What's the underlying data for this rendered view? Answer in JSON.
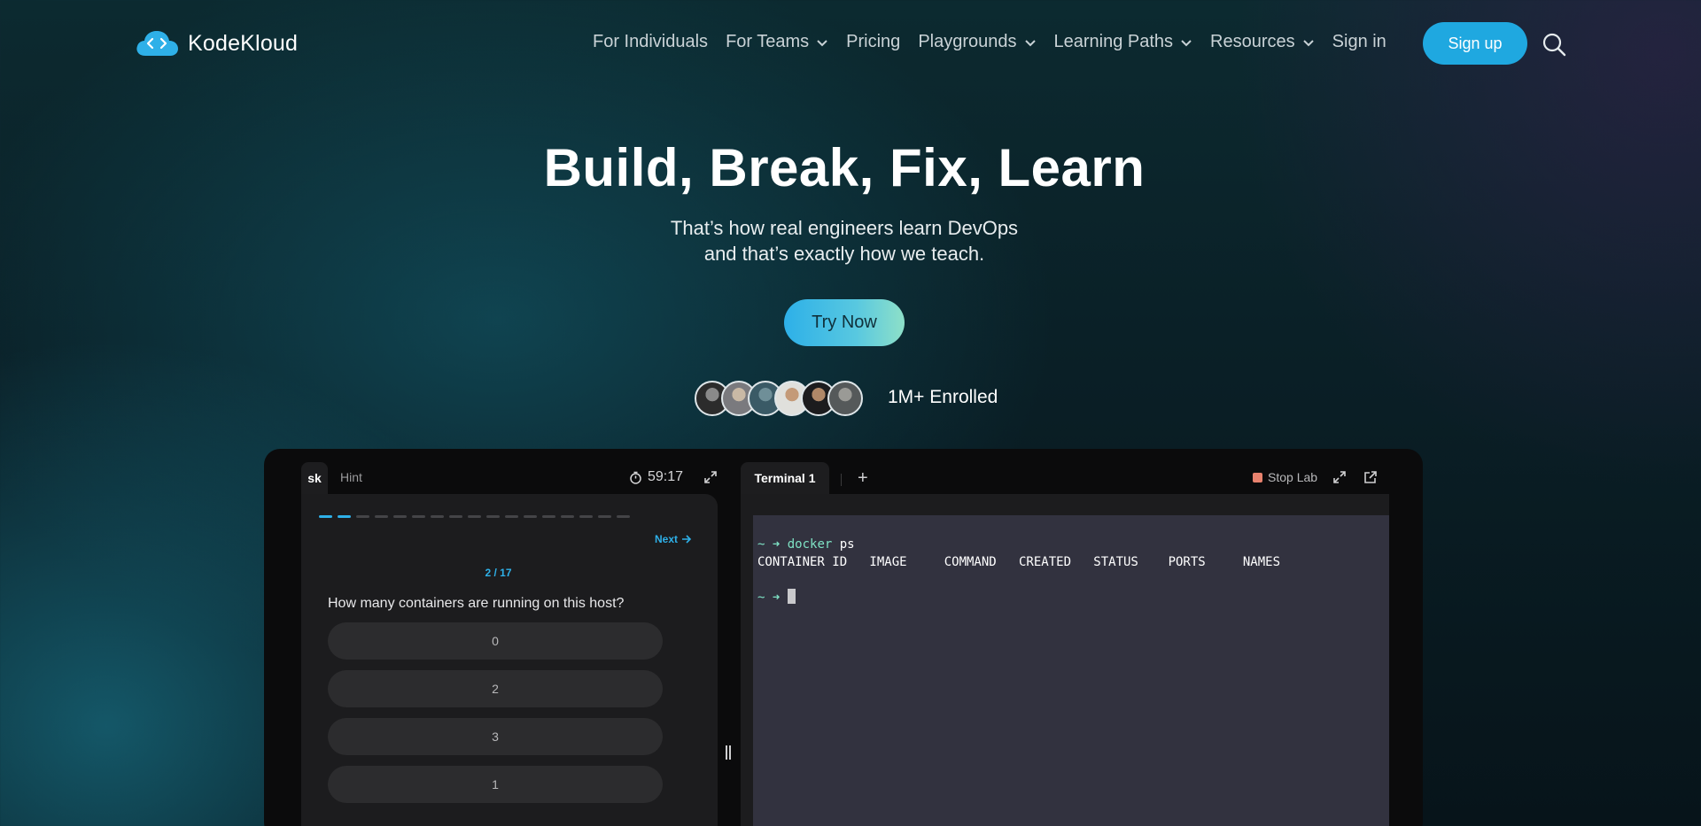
{
  "nav": {
    "brand": "KodeKloud",
    "items": [
      {
        "label": "For Individuals",
        "dropdown": false
      },
      {
        "label": "For Teams",
        "dropdown": true
      },
      {
        "label": "Pricing",
        "dropdown": false
      },
      {
        "label": "Playgrounds",
        "dropdown": true
      },
      {
        "label": "Learning Paths",
        "dropdown": true
      },
      {
        "label": "Resources",
        "dropdown": true
      },
      {
        "label": "Sign in",
        "dropdown": false
      }
    ],
    "signup_label": "Sign up",
    "icons": {
      "search": "search-icon",
      "dropdown": "chevron-down-icon",
      "logo": "cloud-code-icon"
    }
  },
  "hero": {
    "title": "Build, Break, Fix, Learn",
    "subtitle_line1": "That’s how real engineers learn DevOps",
    "subtitle_line2": "and that’s exactly how we teach.",
    "cta_label": "Try Now",
    "enrolled": "1M+ Enrolled",
    "avatar_count": 6
  },
  "lab": {
    "left": {
      "task_tab": "sk",
      "hint_tab": "Hint",
      "timer": "59:17",
      "progress_total": 17,
      "progress_current": 2,
      "next_label": "Next",
      "step_label": "2 / 17",
      "question": "How many containers are running on this host?",
      "options": [
        "0",
        "2",
        "3",
        "1"
      ]
    },
    "right": {
      "terminal_tab": "Terminal 1",
      "add_tab": "+",
      "stop_label": "Stop Lab",
      "lines": {
        "prompt": "~ ➜",
        "cmd_name": "docker",
        "cmd_args": " ps",
        "header": "CONTAINER ID   IMAGE     COMMAND   CREATED   STATUS    PORTS     NAMES"
      }
    }
  },
  "colors": {
    "accent": "#1fa8e0",
    "terminal_bg": "#32323f",
    "prompt": "#7fe3c5",
    "stop": "#e8826e"
  }
}
